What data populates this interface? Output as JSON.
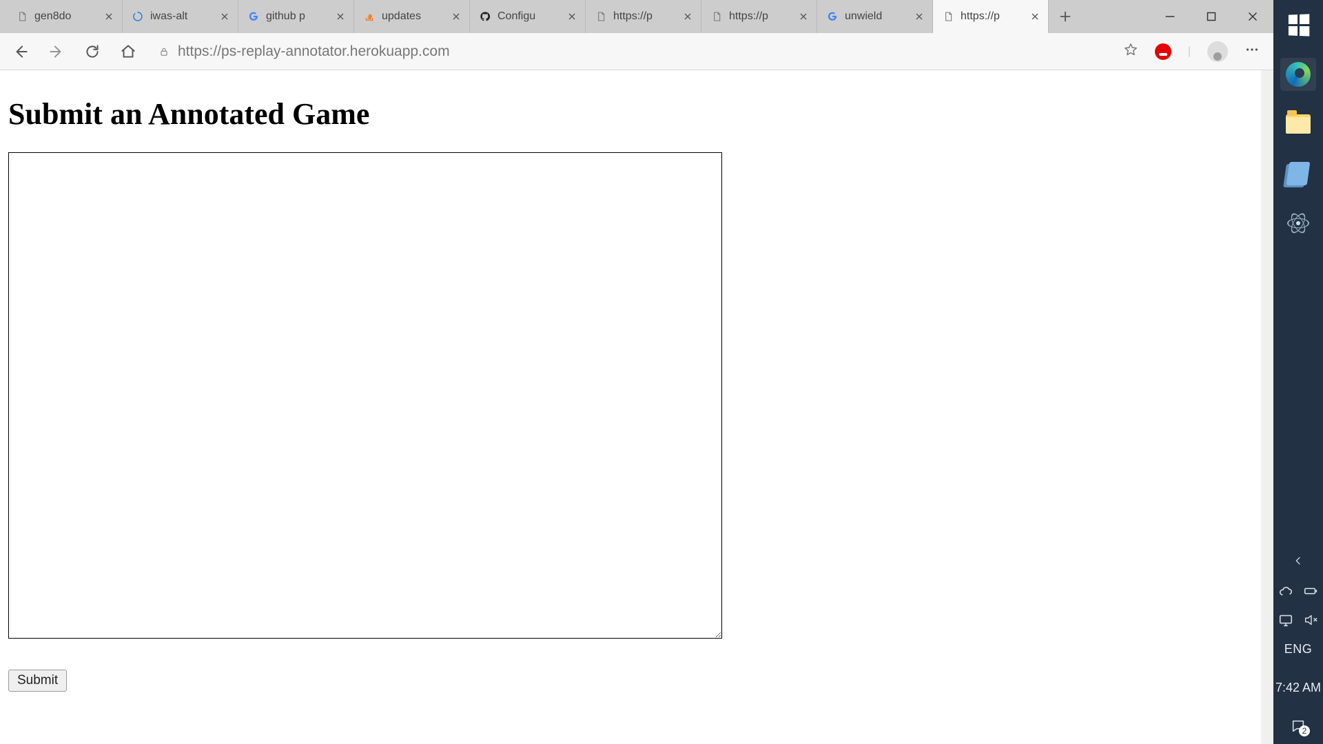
{
  "browser": {
    "tabs": [
      {
        "title": "gen8do",
        "favicon": "page"
      },
      {
        "title": "iwas-alt",
        "favicon": "spinner"
      },
      {
        "title": "github p",
        "favicon": "google"
      },
      {
        "title": "updates",
        "favicon": "stack"
      },
      {
        "title": "Configu",
        "favicon": "github"
      },
      {
        "title": "https://p",
        "favicon": "page"
      },
      {
        "title": "https://p",
        "favicon": "page"
      },
      {
        "title": "unwield",
        "favicon": "google"
      },
      {
        "title": "https://p",
        "favicon": "page",
        "active": true
      }
    ],
    "address": "https://ps-replay-annotator.herokuapp.com"
  },
  "page": {
    "heading": "Submit an Annotated Game",
    "textarea_value": "",
    "submit_label": "Submit"
  },
  "sidebar": {
    "lang": "ENG",
    "clock": "7:42 AM",
    "notif_count": "2"
  }
}
